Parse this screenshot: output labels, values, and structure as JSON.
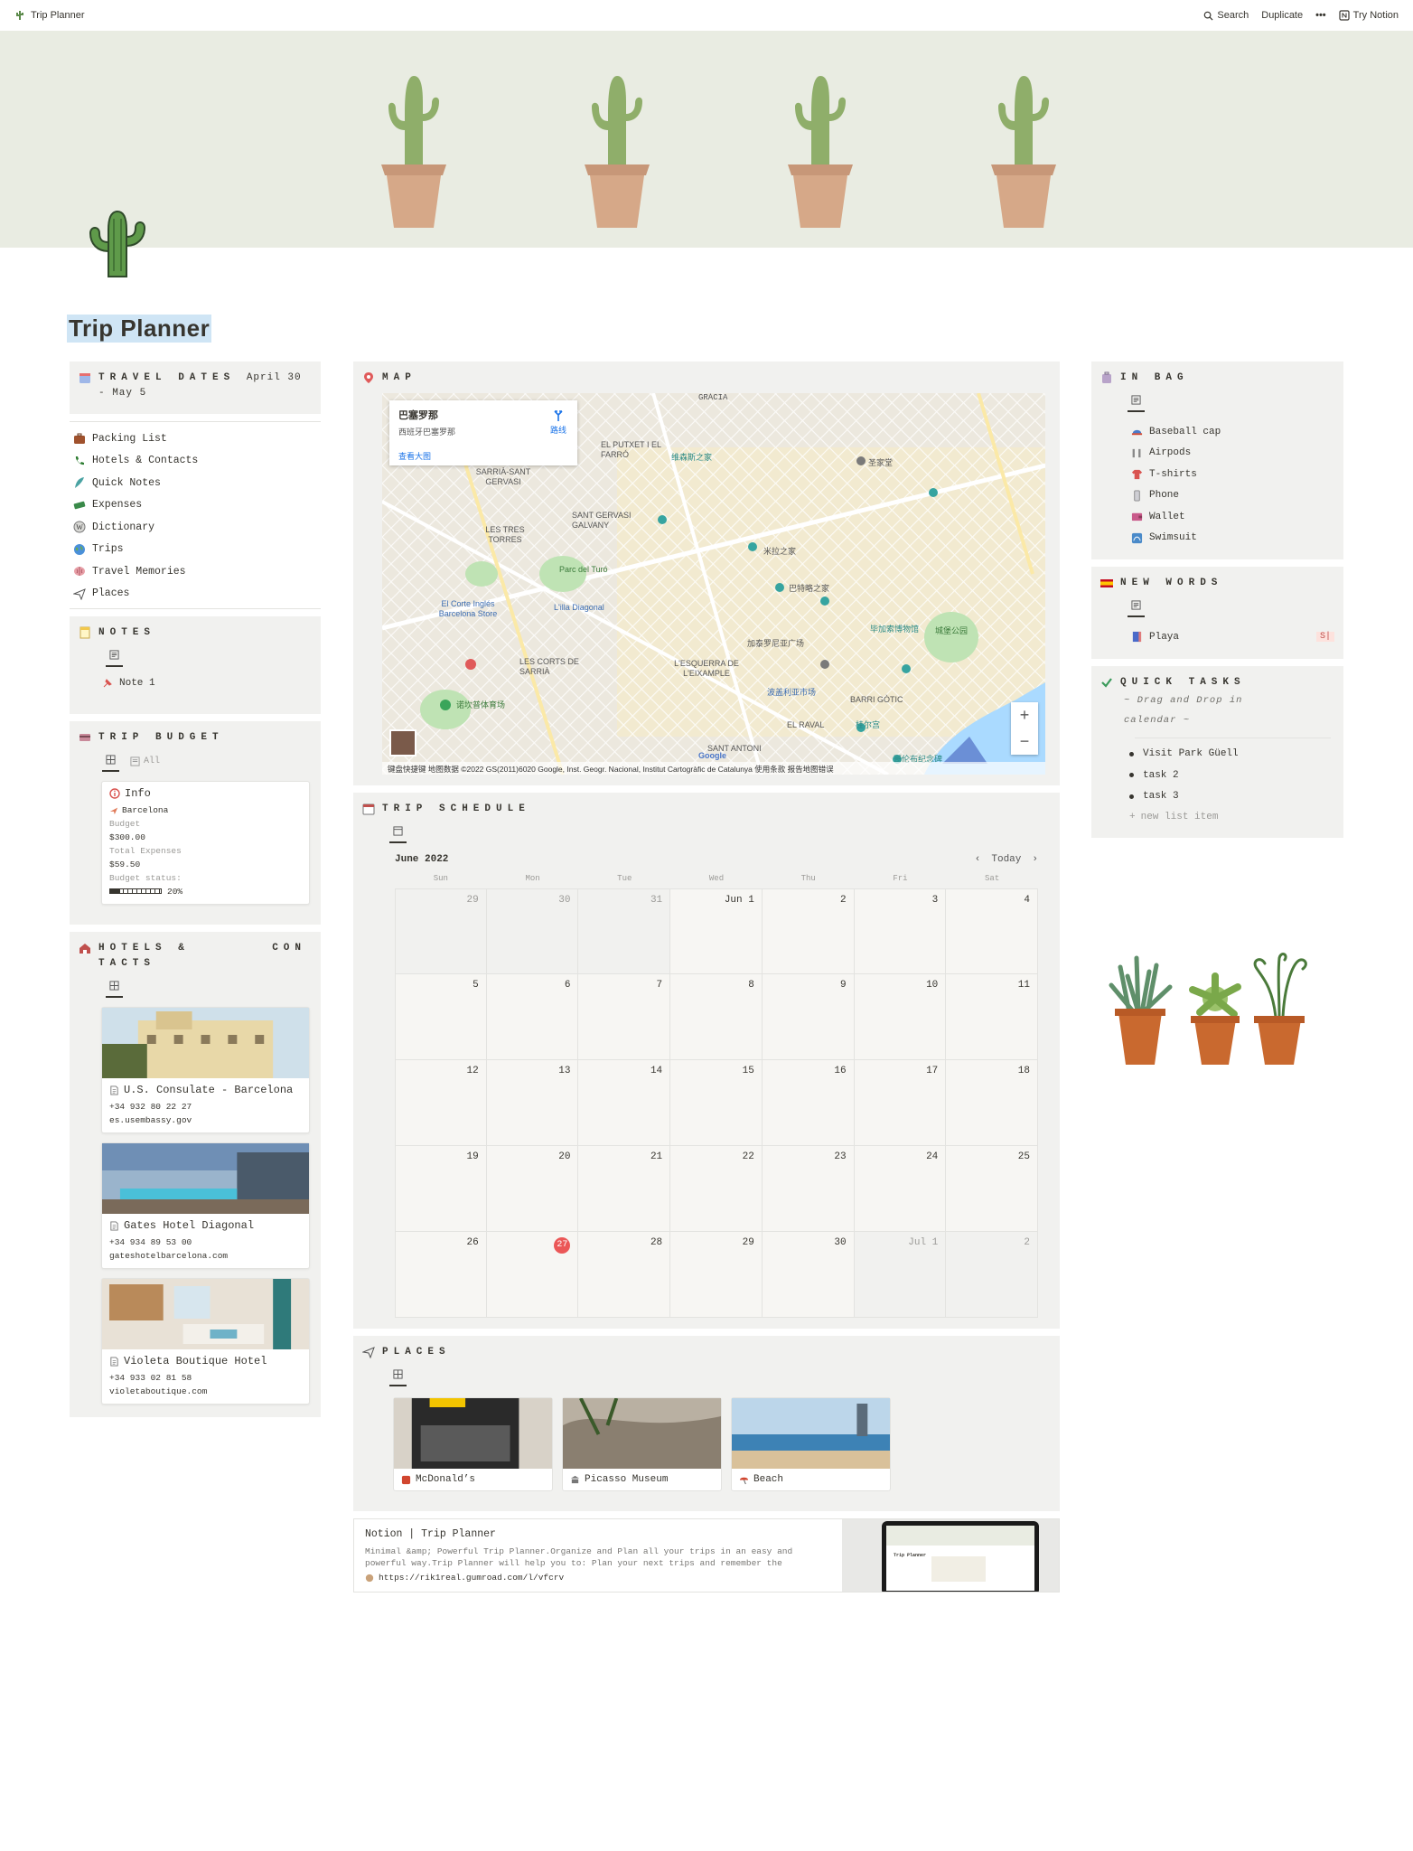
{
  "topbar": {
    "breadcrumb": "Trip Planner",
    "search": "Search",
    "duplicate": "Duplicate",
    "more": "•••",
    "try_notion": "Try Notion"
  },
  "page": {
    "title": "Trip Planner"
  },
  "left": {
    "travel_dates": {
      "title": "TRAVEL DATES",
      "value": "April 30 - May 5"
    },
    "nav": [
      {
        "label": "Packing List",
        "icon": "suitcase-icon"
      },
      {
        "label": "Hotels & Contacts",
        "icon": "phone-icon"
      },
      {
        "label": "Quick Notes",
        "icon": "feather-icon"
      },
      {
        "label": "Expenses",
        "icon": "money-icon"
      },
      {
        "label": "Dictionary",
        "icon": "w-icon"
      },
      {
        "label": "Trips",
        "icon": "globe-icon"
      },
      {
        "label": "Travel Memories",
        "icon": "brain-icon"
      },
      {
        "label": "Places",
        "icon": "paper-plane-icon"
      }
    ],
    "notes": {
      "title": "NOTES",
      "items": [
        "Note 1"
      ]
    },
    "budget": {
      "title": "TRIP BUDGET",
      "view_all": "All",
      "card": {
        "title": "Info",
        "place": "Barcelona",
        "budget_label": "Budget",
        "budget_value": "$300.00",
        "expenses_label": "Total Expenses",
        "expenses_value": "$59.50",
        "status_label": "Budget status:",
        "status_value": "20%",
        "status_fraction": 0.2
      }
    },
    "hotels": {
      "title_line1": "HOTELS &",
      "title_line1b": "CON",
      "title_line2": "TACTS",
      "items": [
        {
          "name": "U.S. Consulate - Barcelona",
          "phone": "+34 932 80 22 27",
          "url": "es.usembassy.gov"
        },
        {
          "name": "Gates Hotel Diagonal",
          "phone": "+34 934 89 53 00",
          "url": "gateshotelbarcelona.com"
        },
        {
          "name": "Violeta Boutique Hotel",
          "phone": "+34 933 02 81 58",
          "url": "violetaboutique.com"
        }
      ]
    }
  },
  "mid": {
    "map": {
      "title": "MAP",
      "info_title": "巴塞罗那",
      "info_subtitle": "西班牙巴塞罗那",
      "info_route": "路线",
      "info_link": "查看大图",
      "attribution": "键盘快捷键   地图数据 ©2022 GS(2011)6020 Google, Inst. Geogr. Nacional, Institut Cartogràfic de Catalunya   使用条款   报告地图错误",
      "labels": [
        "GRÀCIA",
        "EL PUTXET I EL FARRÓ",
        "SARRIÀ-SANT GERVASI",
        "SANT GERVASI GALVANY",
        "LES TRES TORRES",
        "Parc del Turó",
        "巴特略之家",
        "米拉之家",
        "维森斯之家",
        "圣家堂",
        "L'ESQUERRA DE L'EIXAMPLE",
        "LES CORTS DE SARRIÀ",
        "El Corte Inglés Barcelona Store",
        "L'illa Diagonal",
        "加泰罗尼亚广场",
        "BARRI GÒTIC",
        "EL RAVAL",
        "SANT ANTONI",
        "毕加索博物馆",
        "城堡公园",
        "诺坎普体育场",
        "波盖利亚市场",
        "桂尔宫",
        "哥伦布纪念碑",
        "Google"
      ]
    },
    "schedule": {
      "title": "TRIP SCHEDULE",
      "month": "June 2022",
      "today": "Today",
      "weekdays": [
        "Sun",
        "Mon",
        "Tue",
        "Wed",
        "Thu",
        "Fri",
        "Sat"
      ],
      "days": [
        "29",
        "30",
        "31",
        "Jun 1",
        "2",
        "3",
        "4",
        "5",
        "6",
        "7",
        "8",
        "9",
        "10",
        "11",
        "12",
        "13",
        "14",
        "15",
        "16",
        "17",
        "18",
        "19",
        "20",
        "21",
        "22",
        "23",
        "24",
        "25",
        "26",
        "27",
        "28",
        "29",
        "30",
        "Jul 1",
        "2"
      ]
    },
    "places": {
      "title": "PLACES",
      "items": [
        {
          "name": "McDonald’s"
        },
        {
          "name": "Picasso Museum"
        },
        {
          "name": "Beach"
        }
      ]
    },
    "bookmark": {
      "title": "Notion | Trip Planner",
      "description": "Minimal &amp; Powerful Trip Planner.Organize and Plan all your trips in an easy and powerful way.Trip Planner will help you to: Plan your next trips and remember the",
      "url": "https://rik1real.gumroad.com/l/vfcrv",
      "thumb_title": "Trip Planner"
    }
  },
  "right": {
    "in_bag": {
      "title": "IN BAG",
      "items": [
        {
          "label": "Baseball cap",
          "icon": "cap-icon"
        },
        {
          "label": "Airpods",
          "icon": "airpods-icon"
        },
        {
          "label": "T-shirts",
          "icon": "tshirt-icon"
        },
        {
          "label": "Phone",
          "icon": "phone-device-icon"
        },
        {
          "label": "Wallet",
          "icon": "wallet-icon"
        },
        {
          "label": "Swimsuit",
          "icon": "swimsuit-icon"
        }
      ]
    },
    "new_words": {
      "title": "NEW WORDS",
      "items": [
        {
          "label": "Playa",
          "tag": "S|"
        }
      ]
    },
    "quick_tasks": {
      "title": "QUICK TASKS",
      "subtitle_line1": "~ Drag and Drop in",
      "subtitle_line2": "calendar ~",
      "items": [
        "Visit Park Güell",
        "task 2",
        "task 3"
      ],
      "new_item": "new list item"
    }
  },
  "colors": {
    "panel_bg": "#f1f1ef",
    "cover_bg": "#e9ece2",
    "title_highlight": "#cfe5f5",
    "today_red": "#eb5757"
  }
}
